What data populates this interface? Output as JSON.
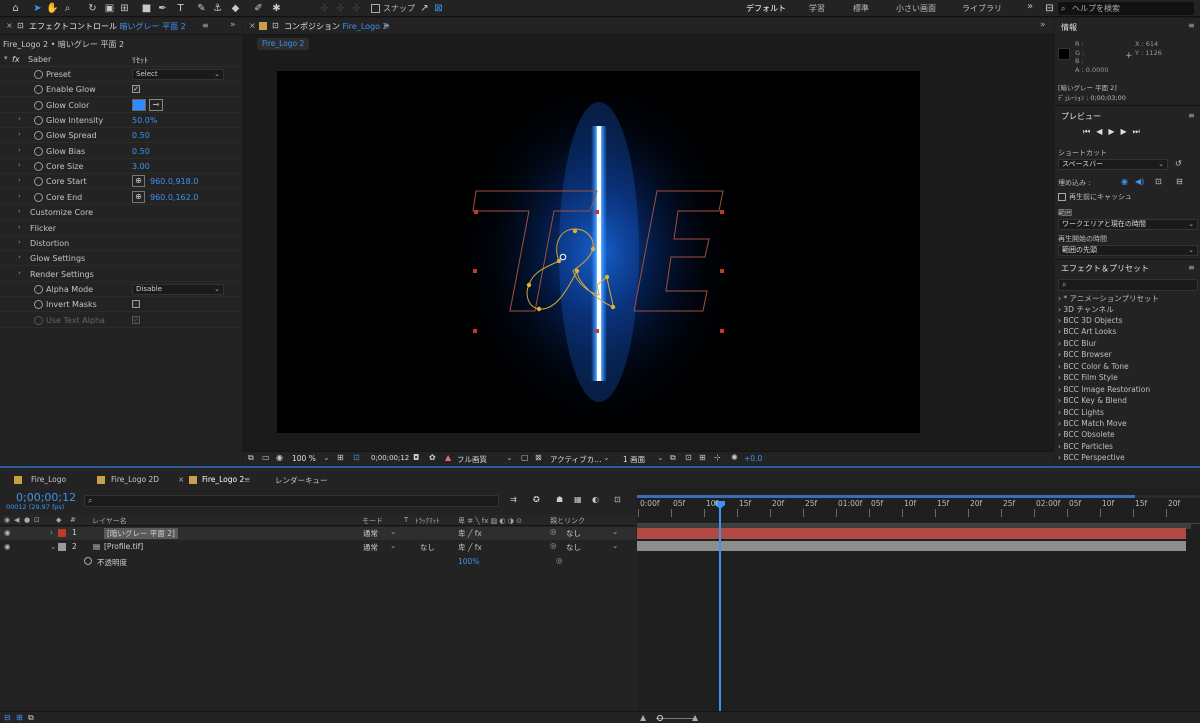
{
  "toolbar": {
    "snap_label": "スナップ",
    "workspaces": [
      "デフォルト",
      "学習",
      "標準",
      "小さい画面",
      "ライブラリ"
    ],
    "help_placeholder": "ヘルプを検索",
    "more_chevron": "»"
  },
  "effect_controls": {
    "tab_title": "エフェクトコントロール",
    "tab_layer": "暗いグレー 平面 2",
    "breadcrumb": "Fire_Logo 2 • 暗いグレー 平面 2",
    "effect_name": "Saber",
    "reset_label": "ﾘｾｯﾄ",
    "fx_label": "fx",
    "rows": [
      {
        "label": "Preset",
        "kind": "dropdown",
        "value": "Select"
      },
      {
        "label": "Enable Glow",
        "kind": "checkbox",
        "checked": true
      },
      {
        "label": "Glow Color",
        "kind": "color",
        "color": "#2f8bff"
      },
      {
        "label": "Glow Intensity",
        "kind": "value",
        "value": "50.0%"
      },
      {
        "label": "Glow Spread",
        "kind": "value",
        "value": "0.50"
      },
      {
        "label": "Glow Bias",
        "kind": "value",
        "value": "0.50"
      },
      {
        "label": "Core Size",
        "kind": "value",
        "value": "3.00"
      },
      {
        "label": "Core Start",
        "kind": "point",
        "value": "960.0,918.0"
      },
      {
        "label": "Core End",
        "kind": "point",
        "value": "960.0,162.0"
      },
      {
        "label": "Customize Core",
        "kind": "group"
      },
      {
        "label": "Flicker",
        "kind": "group"
      },
      {
        "label": "Distortion",
        "kind": "group"
      },
      {
        "label": "Glow Settings",
        "kind": "group"
      },
      {
        "label": "Render Settings",
        "kind": "group"
      },
      {
        "label": "Alpha Mode",
        "kind": "dropdown",
        "value": "Disable"
      },
      {
        "label": "Invert Masks",
        "kind": "checkbox",
        "checked": false
      },
      {
        "label": "Use Text Alpha",
        "kind": "checkbox-disabled",
        "checked": true
      }
    ]
  },
  "composition": {
    "tab_title": "コンポジション",
    "tab_name": "Fire_Logo 2",
    "sub_tab": "Fire_Logo 2",
    "logo_text": "T&E",
    "saber_color": "#2f8bff",
    "bottom": {
      "zoom": "100 %",
      "timecode": "0;00;00;12",
      "resolution": "フル画質",
      "camera": "アクティブカ…",
      "views": "1 画面",
      "exposure": "+0.0"
    }
  },
  "info": {
    "title": "情報",
    "r": "R :",
    "g": "G :",
    "b": "B :",
    "a": "A : 0.0000",
    "x": "X : 614",
    "y": "Y : 1126",
    "layer": "[暗いグレー 平面 2]",
    "duration": "ﾃﾞｭﾚｰｼｮﾝ : 0;00;03;00"
  },
  "preview": {
    "title": "プレビュー",
    "shortcut_label": "ショートカット",
    "shortcut_value": "スペースバー",
    "embed_label": "埋め込み :",
    "cache_label": "再生前にキャッシュ",
    "range_label": "範囲",
    "range_value": "ワークエリアと現在の時間",
    "start_label": "再生開始の時間",
    "start_value": "範囲の先頭"
  },
  "effects_presets": {
    "title": "エフェクト＆プリセット",
    "search_placeholder": "",
    "items": [
      "* アニメーションプリセット",
      "3D チャンネル",
      "BCC 3D Objects",
      "BCC Art Looks",
      "BCC Blur",
      "BCC Browser",
      "BCC Color & Tone",
      "BCC Film Style",
      "BCC Image Restoration",
      "BCC Key & Blend",
      "BCC Lights",
      "BCC Match Move",
      "BCC Obsolete",
      "BCC Particles",
      "BCC Perspective"
    ]
  },
  "timeline": {
    "tabs": [
      "Fire_Logo",
      "Fire_Logo 2D",
      "Fire_Logo 2",
      "レンダーキュー"
    ],
    "timecode": "0;00;00;12",
    "frames": "00012 (29.97 fps)",
    "headers": {
      "num": "#",
      "layer_name": "レイヤー名",
      "mode": "モード",
      "t": "T",
      "track_matte": "ﾄﾗｯｸﾏｯﾄ",
      "parent": "親とリンク"
    },
    "layers": [
      {
        "num": "1",
        "name": "[暗いグレー 平面 2]",
        "mode": "通常",
        "matte": "",
        "parent": "なし",
        "color": "#c0392b"
      },
      {
        "num": "2",
        "name": "[Profile.tif]",
        "mode": "通常",
        "matte": "なし",
        "parent": "なし",
        "color": "#9a9a9a"
      }
    ],
    "property": {
      "name": "不透明度",
      "value": "100%"
    },
    "ruler": [
      "0:00f",
      "05f",
      "10f",
      "15f",
      "20f",
      "25f",
      "01:00f",
      "05f",
      "10f",
      "15f",
      "20f",
      "25f",
      "02:00f",
      "05f",
      "10f",
      "15f",
      "20f"
    ]
  }
}
